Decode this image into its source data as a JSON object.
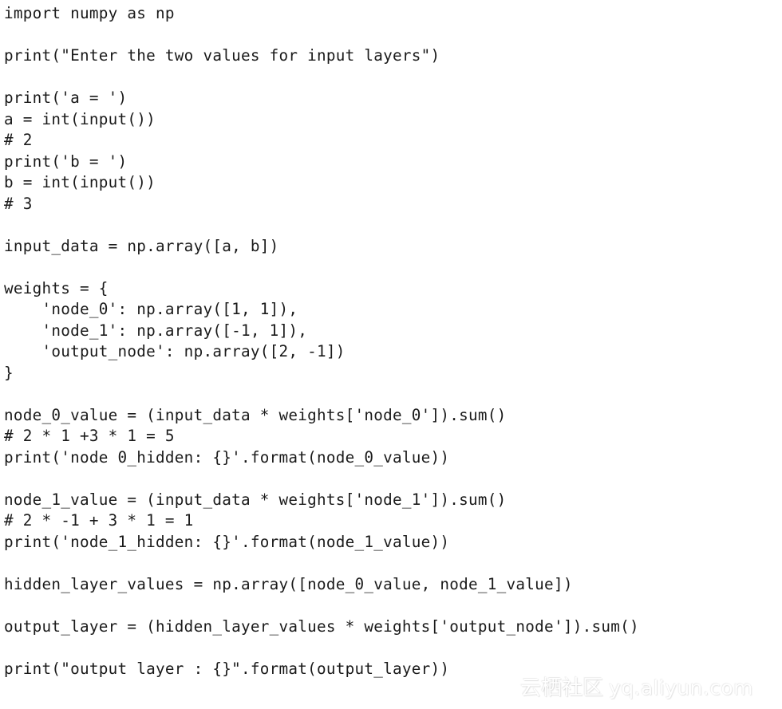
{
  "document": {
    "kind": "python-source-code-screenshot",
    "language": "Python",
    "background_color": "#ffffff",
    "text_color": "#1a1a1a"
  },
  "code": {
    "lines": [
      "import numpy as np",
      "",
      "print(\"Enter the two values for input layers\")",
      "",
      "print('a = ')",
      "a = int(input())",
      "# 2",
      "print('b = ')",
      "b = int(input())",
      "# 3",
      "",
      "input_data = np.array([a, b])",
      "",
      "weights = {",
      "    'node_0': np.array([1, 1]),",
      "    'node_1': np.array([-1, 1]),",
      "    'output_node': np.array([2, -1])",
      "}",
      "",
      "node_0_value = (input_data * weights['node_0']).sum()",
      "# 2 * 1 +3 * 1 = 5",
      "print('node 0_hidden: {}'.format(node_0_value))",
      "",
      "node_1_value = (input_data * weights['node_1']).sum()",
      "# 2 * -1 + 3 * 1 = 1",
      "print('node_1_hidden: {}'.format(node_1_value))",
      "",
      "hidden_layer_values = np.array([node_0_value, node_1_value])",
      "",
      "output_layer = (hidden_layer_values * weights['output_node']).sum()",
      "",
      "print(\"output layer : {}\".format(output_layer))"
    ]
  },
  "watermark": {
    "brand_cn": "云栖社区",
    "url": "yq.aliyun.com",
    "color": "#ffffff"
  }
}
